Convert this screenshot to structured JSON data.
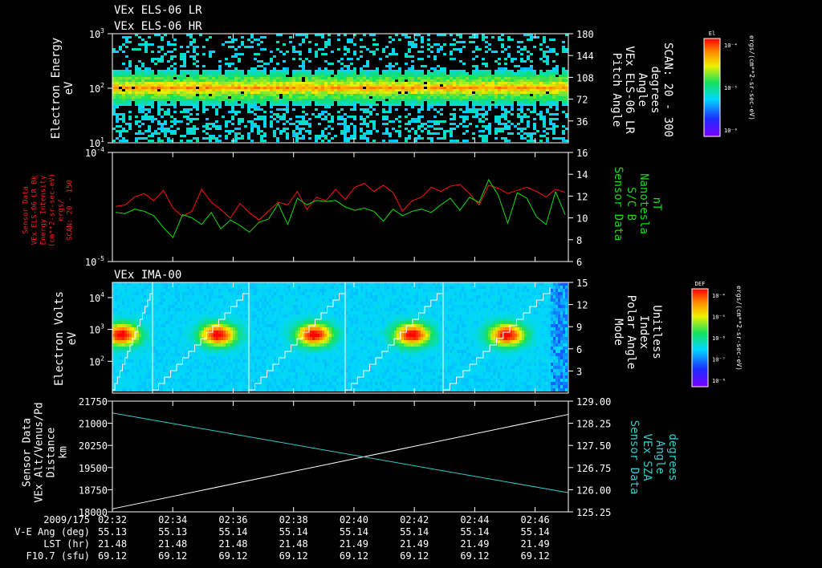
{
  "titles": {
    "top1": "VEx ELS-06 LR",
    "top2": "VEx ELS-06 HR",
    "ima": "VEx IMA-00"
  },
  "panel1": {
    "left_label": [
      "Electron Energy",
      "eV"
    ],
    "right_label": [
      "Pitch Angle",
      "VEx ELS-06 LR",
      "Angle",
      "degrees",
      "SCAN: 20 - 300"
    ],
    "left_ticks": [
      {
        "base": "10",
        "exp": "1"
      },
      {
        "base": "10",
        "exp": "2"
      },
      {
        "base": "10",
        "exp": "3"
      }
    ],
    "right_ticks": [
      "36",
      "72",
      "108",
      "144",
      "180"
    ],
    "colorbar": {
      "title": "El",
      "ticks": [
        "10⁻⁴",
        "10⁻⁵",
        "10⁻⁶"
      ],
      "unit": "ergs/(cm**2-sr-sec-eV)"
    }
  },
  "panel2": {
    "left_label": [
      "Sensor Data",
      "VEx ELS-06 LR Bk",
      "Energy Intensity",
      "(cm**2-sr-sec-eV)",
      "ergs/",
      "SCAN: 20 - 150"
    ],
    "right_label": [
      "Sensor Data",
      "S/C B",
      "Nanotesla",
      "nT"
    ],
    "left_ticks": [
      {
        "base": "10",
        "exp": "-5"
      },
      {
        "base": "10",
        "exp": "-4"
      }
    ],
    "right_ticks": [
      "6",
      "8",
      "10",
      "12",
      "14",
      "16"
    ],
    "colors": {
      "red_series": "#ff1010",
      "green_series": "#10dd10"
    }
  },
  "panel3": {
    "left_label": [
      "Electron Volts",
      "eV"
    ],
    "right_label": [
      "Mode",
      "Polar Angle",
      "Index",
      "Unitless"
    ],
    "left_ticks": [
      {
        "base": "10",
        "exp": "2"
      },
      {
        "base": "10",
        "exp": "3"
      },
      {
        "base": "10",
        "exp": "4"
      }
    ],
    "right_ticks": [
      "3",
      "6",
      "9",
      "12",
      "15"
    ],
    "colorbar": {
      "title": "DEF",
      "ticks": [
        "10⁻⁴",
        "10⁻⁵",
        "10⁻⁶",
        "10⁻⁷",
        "10⁻⁸"
      ],
      "unit": "ergs/(cm**2-sr-sec-eV)"
    }
  },
  "panel4": {
    "left_label": [
      "Sensor Data",
      "VEx Alt/Venus/Pd",
      "Distance",
      "km"
    ],
    "right_label": [
      "Sensor Data",
      "VEx SZA",
      "Angle",
      "degrees"
    ],
    "left_ticks": [
      "18000",
      "18750",
      "19500",
      "20250",
      "21000",
      "21750"
    ],
    "right_ticks": [
      "125.25",
      "126.00",
      "126.75",
      "127.50",
      "128.25",
      "129.00"
    ],
    "colors": {
      "white_series": "#ffffff",
      "cyan_series": "#33cccc"
    }
  },
  "footer": {
    "row_labels": [
      "2009/175",
      "V-E Ang (deg)",
      "LST (hr)",
      "F10.7 (sfu)"
    ],
    "times": [
      "02:32",
      "02:34",
      "02:36",
      "02:38",
      "02:40",
      "02:42",
      "02:44",
      "02:46"
    ],
    "ve_ang": [
      "55.13",
      "55.13",
      "55.14",
      "55.14",
      "55.14",
      "55.14",
      "55.14",
      "55.14"
    ],
    "lst": [
      "21.48",
      "21.48",
      "21.48",
      "21.48",
      "21.49",
      "21.49",
      "21.49",
      "21.49"
    ],
    "f107": [
      "69.12",
      "69.12",
      "69.12",
      "69.12",
      "69.12",
      "69.12",
      "69.12",
      "69.12"
    ]
  },
  "chart_data": [
    {
      "type": "heatmap",
      "title": "VEx ELS-06 LR / VEx ELS-06 HR",
      "ylabel": "Electron Energy eV",
      "yscale": "log",
      "ylim": [
        1,
        1000
      ],
      "y2label": "Pitch Angle VEx ELS-06 LR Angle degrees SCAN: 20 - 300",
      "y2lim": [
        0,
        180
      ],
      "colorbar_label": "El ergs/(cm**2-sr-sec-eV)",
      "colorbar_range": [
        1e-06,
        0.0001
      ],
      "peak_energy_eV": [
        20,
        50
      ],
      "n_sweeps": 30
    },
    {
      "type": "line",
      "ylabel": "Sensor Data VEx ELS-06 LR Bk Energy Intensity ergs/(cm**2-sr-sec-eV) SCAN: 20 - 150",
      "yscale": "log",
      "ylim": [
        1e-05,
        0.0001
      ],
      "y2label": "Sensor Data S/C B Nanotesla nT",
      "y2lim": [
        6,
        16
      ],
      "series": [
        {
          "color": "red",
          "axis": "left",
          "values": [
            3.2e-05,
            3.3e-05,
            3.9e-05,
            4.2e-05,
            3.6e-05,
            4.5e-05,
            3.1e-05,
            2.6e-05,
            2.9e-05,
            4.6e-05,
            3.5e-05,
            3e-05,
            2.5e-05,
            3.4e-05,
            2.8e-05,
            2.4e-05,
            2.9e-05,
            3.5e-05,
            3.3e-05,
            4.4e-05,
            3e-05,
            3.9e-05,
            3.6e-05,
            4.6e-05,
            3.7e-05,
            4.8e-05,
            5.2e-05,
            4.4e-05,
            5e-05,
            4.3e-05,
            2.9e-05,
            3.6e-05,
            3.9e-05,
            4.8e-05,
            4.4e-05,
            4.9e-05,
            5.1e-05,
            4.2e-05,
            3.3e-05,
            5e-05,
            4.7e-05,
            4.2e-05,
            4.5e-05,
            4.8e-05,
            4.4e-05,
            3.9e-05,
            4.6e-05,
            4.3e-05
          ]
        },
        {
          "color": "green",
          "axis": "right",
          "values": [
            10.5,
            10.4,
            10.8,
            10.6,
            10.2,
            9.1,
            8.2,
            10.3,
            10.0,
            9.4,
            10.5,
            9.0,
            9.8,
            9.3,
            8.7,
            9.6,
            9.9,
            11.3,
            9.4,
            11.8,
            11.2,
            11.6,
            11.5,
            11.6,
            11.0,
            10.7,
            10.9,
            10.6,
            9.7,
            10.8,
            10.2,
            10.6,
            10.8,
            10.5,
            11.2,
            11.8,
            10.7,
            11.9,
            11.4,
            13.5,
            12.1,
            9.5,
            12.3,
            11.8,
            10.1,
            9.4,
            12.4,
            10.3
          ]
        }
      ]
    },
    {
      "type": "heatmap",
      "title": "VEx IMA-00",
      "ylabel": "Electron Volts eV",
      "yscale": "log",
      "ylim": [
        10,
        30000
      ],
      "y2label": "Mode Polar Angle Index Unitless",
      "y2lim": [
        0,
        15
      ],
      "colorbar_label": "DEF ergs/(cm**2-sr-sec-eV)",
      "colorbar_range": [
        1e-08,
        0.0001
      ],
      "scan_boundaries": [
        "02:35",
        "02:38",
        "02:41",
        "02:44"
      ]
    },
    {
      "type": "line",
      "ylabel": "Sensor Data VEx Alt/Venus/Pd Distance km",
      "ylim": [
        18000,
        21750
      ],
      "y2label": "Sensor Data VEx SZA Angle degrees",
      "y2lim": [
        125.25,
        129.0
      ],
      "x": [
        "02:32",
        "02:47"
      ],
      "series": [
        {
          "color": "white",
          "axis": "left",
          "values": [
            18100,
            21300
          ]
        },
        {
          "color": "cyan",
          "axis": "right",
          "values": [
            128.6,
            125.9
          ]
        }
      ]
    }
  ]
}
